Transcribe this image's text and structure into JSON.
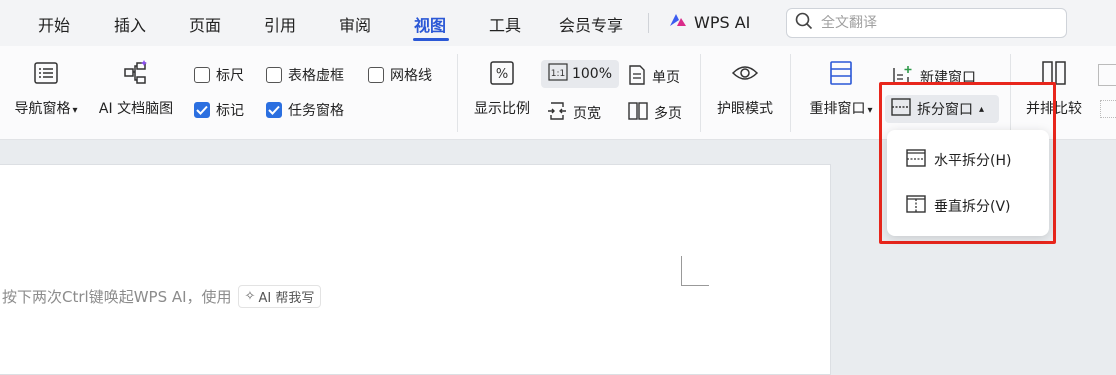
{
  "menubar": {
    "tabs": [
      {
        "label": "开始"
      },
      {
        "label": "插入"
      },
      {
        "label": "页面"
      },
      {
        "label": "引用"
      },
      {
        "label": "审阅"
      },
      {
        "label": "视图",
        "active": true
      },
      {
        "label": "工具"
      },
      {
        "label": "会员专享"
      }
    ],
    "wps_ai_label": "WPS AI",
    "search_placeholder": "全文翻译"
  },
  "ribbon": {
    "nav_pane": "导航窗格",
    "ai_mindmap": "AI 文档脑图",
    "checkboxes": [
      {
        "label": "标尺",
        "checked": false
      },
      {
        "label": "表格虚框",
        "checked": false
      },
      {
        "label": "网格线",
        "checked": false
      },
      {
        "label": "标记",
        "checked": true
      },
      {
        "label": "任务窗格",
        "checked": true
      }
    ],
    "zoom_label": "显示比例",
    "zoom_value": "100%",
    "page_width": "页宽",
    "single_page": "单页",
    "multi_page": "多页",
    "eye_mode": "护眼模式",
    "rearrange": "重排窗口",
    "new_window": "新建窗口",
    "split_window": "拆分窗口",
    "side_by_side": "并排比较"
  },
  "dropdown": {
    "items": [
      {
        "label": "水平拆分(H)"
      },
      {
        "label": "垂直拆分(V)"
      }
    ]
  },
  "document": {
    "hint_text": "按下两次Ctrl键唤起WPS AI，使用",
    "hint_button": "AI 帮我写"
  },
  "colors": {
    "accent": "#2b58d6",
    "highlight": "#e8261c",
    "checkbox": "#2b6fe0"
  }
}
